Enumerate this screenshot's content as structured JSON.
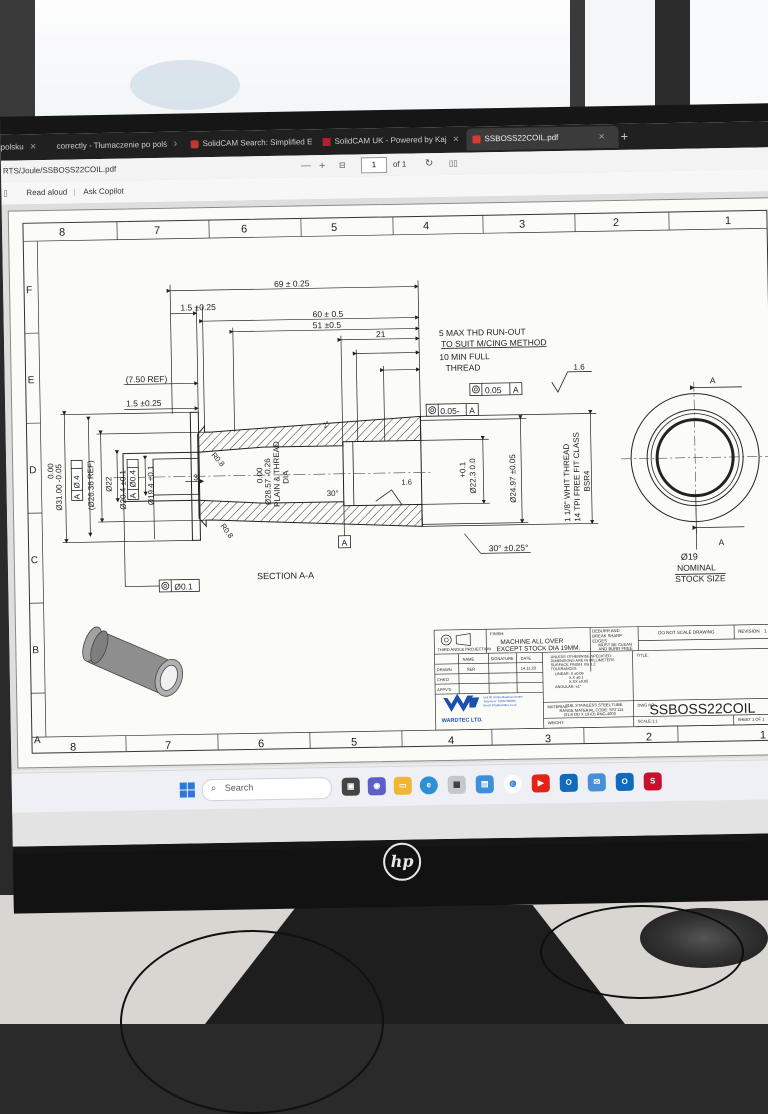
{
  "browser": {
    "tabs": [
      {
        "label": "polsku"
      },
      {
        "label": "correctly - Tłumaczenie po polś"
      },
      {
        "label": "SolidCAM Search: Simplified E"
      },
      {
        "label": "SolidCAM UK - Powered by Kaj"
      },
      {
        "label": "SSBOSS22COIL.pdf"
      }
    ],
    "address": "RTS/Joule/SSBOSS22COIL.pdf",
    "toolbar": {
      "read_aloud": "Read aloud",
      "ask_copilot": "Ask Copilot",
      "page_current": "1",
      "page_total": "of 1"
    }
  },
  "drawing": {
    "zone_columns": [
      "8",
      "7",
      "6",
      "5",
      "4",
      "3",
      "2",
      "1"
    ],
    "zone_rows": [
      "F",
      "E",
      "D",
      "C",
      "B",
      "A"
    ],
    "dims": {
      "overall": "69 ± 0.25",
      "flange": "1.5 ±0.25",
      "len60": "60 ± 0.5",
      "len51": "51 ±0.5",
      "len21": "21",
      "ref750": "(7.50 REF)",
      "flange2": "1.5 ±0.25",
      "three": "3",
      "r08a": "R0.8",
      "r08b": "R0.8",
      "d31": "Ø31.00 -0.05",
      "d31b": "0.00",
      "d2636": "(Ø26.36 REF)",
      "d22": "Ø22",
      "d204": "Ø20.4 ±0.1",
      "d194": "Ø19.4 ±0.1",
      "d285": "Ø28.57 -0.26",
      "d285b": "0.00",
      "plain": "PLAIN & THREAD",
      "dia": "DIA",
      "d223": "Ø22.3 0.0",
      "d223b": "+0.1",
      "d2497": "Ø24.97 ±0.05",
      "thread": "1 1/8\" WHIT THREAD",
      "tpi": "14 TPI FREE FIT CLASS",
      "bsr4": "BSR4",
      "ang30": "30°",
      "ang30b": "30° ±0.25°",
      "deg2": "2°",
      "rough": "1.6",
      "rough2": "1.6",
      "note1": "5 MAX THD RUN-OUT",
      "note2": "TO SUIT M/CING METHOD",
      "note3": "10 MIN FULL",
      "note4": "THREAD",
      "fcf1": "0.05",
      "fcf1ref": "A",
      "fcf2": "0.05-",
      "fcf2ref": "A",
      "fcf3": "Ø0.1",
      "fcfa1": "Ø.4",
      "fcfa1ref": "A",
      "fcfa2": "Ø0.4",
      "fcfa2ref": "A",
      "datum": "A",
      "section": "SECTION A-A",
      "endA1": "A",
      "endA2": "A",
      "end19": "Ø19",
      "nominal": "NOMINAL",
      "stock": "STOCK SIZE"
    },
    "titleblock": {
      "projection": "THIRD ANGLE PROJECTION",
      "finish_label": "FINISH:",
      "finish1": "MACHINE ALL OVER",
      "finish2": "EXCEPT STOCK DIA 19MM.",
      "deburr1": "DEBURR AND",
      "deburr2": "BREAK SHARP",
      "deburr3": "EDGES",
      "clean1": "MUST BE CLEAN",
      "clean2": "AND BURR FREE",
      "noscale": "DO NOT SCALE DRAWING",
      "revision": "REVISION",
      "rev_value": "1",
      "tol1": "UNLESS OTHERWISE SPECIFIED:",
      "tol2": "DIMENSIONS ARE IN MILLIMETERS",
      "tol3": "SURFACE FINISH: Ra 3.2",
      "tol4": "TOLERANCES:",
      "tol5": "LINEAR:  X     ±0.05",
      "tol6": "X.X      ±0.1",
      "tol7": "X.XX   ±0.05",
      "tol8": "ANGULAR: ±1°",
      "title_label": "TITLE:",
      "name_h": "NAME",
      "sig_h": "SIGNATURE",
      "date_h": "DATE",
      "drawn": "DRAWN",
      "drawn_by": "SER",
      "drawn_date": "14.11.23",
      "chkd": "CHK'D",
      "appvd": "APPV'D",
      "company": "WARDTEC LTD.",
      "address1": "Unit 30 Veritas Business Centre",
      "address2": "Telephone: 01452 530055",
      "address3": "Email: info@wardtec.co.uk",
      "material_label": "MATERIAL:",
      "material1": "316L STAINLESS STEEL TUBE",
      "material2": "RANGE MATERIAL CODE: SST114",
      "material3": "(31.8 OD X 19 ID) RNG-4003",
      "dwgno_label": "DWG NO.",
      "dwgno": "SSBOSS22COIL",
      "weight": "WEIGHT:",
      "scale": "SCALE:1:1",
      "sheet": "SHEET 1 OF 1"
    }
  },
  "taskbar": {
    "search_placeholder": "Search"
  },
  "colors": {
    "line": "#222222",
    "hatch": "#333333",
    "accent_blue": "#1d4fb0",
    "windows_blue": "#2b78d6"
  }
}
